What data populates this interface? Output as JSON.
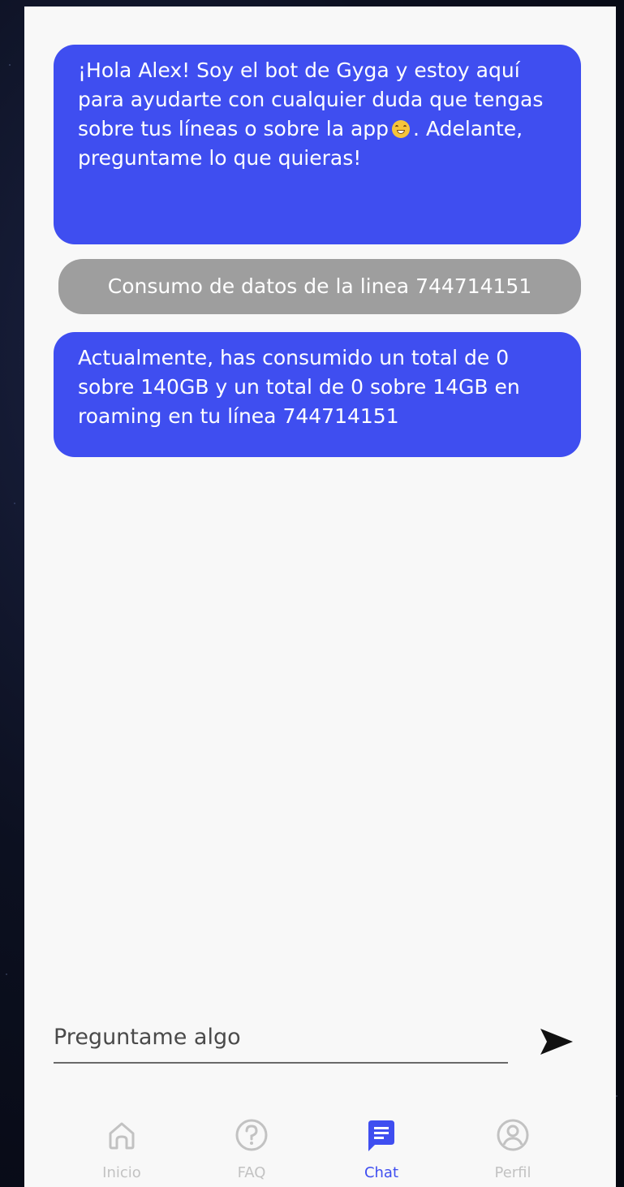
{
  "messages": [
    {
      "role": "bot",
      "text_before": "¡Hola Alex! Soy el bot de Gyga y estoy aquí para ayudarte con cualquier duda que tengas sobre tus líneas o sobre la app",
      "emoji": "grinning-face-icon",
      "text_after": ". Adelante, preguntame lo que quieras!"
    },
    {
      "role": "user",
      "text": "Consumo de datos de la linea 744714151"
    },
    {
      "role": "bot",
      "text": "Actualmente, has consumido un total de 0 sobre 140GB y un total de 0 sobre 14GB en roaming en tu línea 744714151"
    }
  ],
  "input": {
    "placeholder": "Preguntame algo",
    "value": ""
  },
  "send_icon": "send-icon",
  "nav": {
    "items": [
      {
        "label": "Inicio",
        "icon": "home-icon",
        "active": false
      },
      {
        "label": "FAQ",
        "icon": "question-icon",
        "active": false
      },
      {
        "label": "Chat",
        "icon": "chat-icon",
        "active": true
      },
      {
        "label": "Perfil",
        "icon": "profile-icon",
        "active": false
      }
    ]
  },
  "colors": {
    "accent": "#3f4ef0",
    "user_bubble": "#9e9e9e",
    "inactive": "#c2c2c2",
    "background": "#f8f8f8"
  }
}
